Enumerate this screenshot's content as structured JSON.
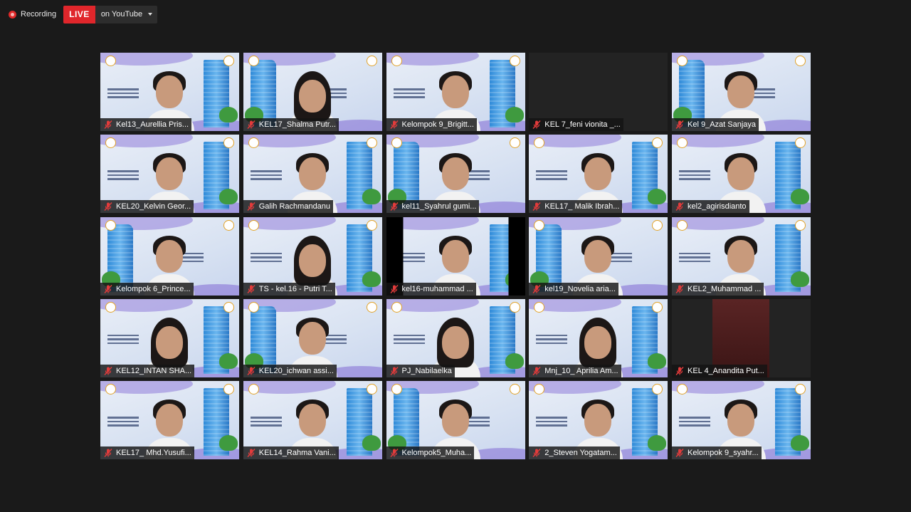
{
  "topbar": {
    "recording_label": "Recording",
    "live_badge": "LIVE",
    "live_target": "on YouTube"
  },
  "colors": {
    "live_red": "#e0262b",
    "recording_dot": "#e02828",
    "background": "#1a1a1a"
  },
  "participants": [
    {
      "name": "Kel13_Aurellia Pris...",
      "muted": true,
      "style": "light"
    },
    {
      "name": "KEL17_Shalma Putr...",
      "muted": true,
      "style": "light"
    },
    {
      "name": "Kelompok 9_Brigitt...",
      "muted": true,
      "style": "light"
    },
    {
      "name": "KEL 7_feni vionita _...",
      "muted": true,
      "style": "dark"
    },
    {
      "name": "Kel 9_Azat Sanjaya",
      "muted": true,
      "style": "light"
    },
    {
      "name": "KEL20_Kelvin Geor...",
      "muted": true,
      "style": "light"
    },
    {
      "name": "Galih Rachmandanu",
      "muted": true,
      "style": "light"
    },
    {
      "name": "kel11_Syahrul gumi...",
      "muted": true,
      "style": "light"
    },
    {
      "name": "KEL17_ Malik Ibrah...",
      "muted": true,
      "style": "light"
    },
    {
      "name": "kel2_agirisdianto",
      "muted": true,
      "style": "light"
    },
    {
      "name": "Kelompok 6_Prince...",
      "muted": true,
      "style": "light"
    },
    {
      "name": "TS - kel.16 - Putri T...",
      "muted": true,
      "style": "light"
    },
    {
      "name": "kel16-muhammad ...",
      "muted": true,
      "style": "letterbox"
    },
    {
      "name": "kel19_Novelia aria...",
      "muted": true,
      "style": "light"
    },
    {
      "name": "KEL2_Muhammad ...",
      "muted": true,
      "style": "light"
    },
    {
      "name": "KEL12_INTAN SHA...",
      "muted": true,
      "style": "light"
    },
    {
      "name": "KEL20_ichwan assi...",
      "muted": true,
      "style": "light"
    },
    {
      "name": "PJ_Nabilaelka",
      "muted": true,
      "style": "light"
    },
    {
      "name": "Mnj_10_ Aprilia Am...",
      "muted": true,
      "style": "light"
    },
    {
      "name": "KEL 4_Anandita Put...",
      "muted": true,
      "style": "darkcam"
    },
    {
      "name": "KEL17_ Mhd.Yusufi...",
      "muted": true,
      "style": "light"
    },
    {
      "name": "KEL14_Rahma Vani...",
      "muted": true,
      "style": "light"
    },
    {
      "name": "Kelompok5_Muha...",
      "muted": true,
      "style": "light"
    },
    {
      "name": "2_Steven Yogatam...",
      "muted": true,
      "style": "light"
    },
    {
      "name": "Kelompok 9_syahr...",
      "muted": true,
      "style": "light"
    }
  ]
}
